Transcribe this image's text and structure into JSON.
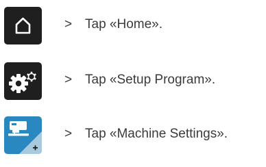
{
  "steps": [
    {
      "marker": ">",
      "text": "Tap «Home».",
      "icon": "home-icon",
      "button_color": "#1f1f1f"
    },
    {
      "marker": ">",
      "text": "Tap «Setup Program».",
      "icon": "gears-icon",
      "button_color": "#1f1f1f"
    },
    {
      "marker": ">",
      "text": "Tap «Machine Settings».",
      "icon": "sewing-machine-icon",
      "button_color": "#2a88c1"
    }
  ]
}
